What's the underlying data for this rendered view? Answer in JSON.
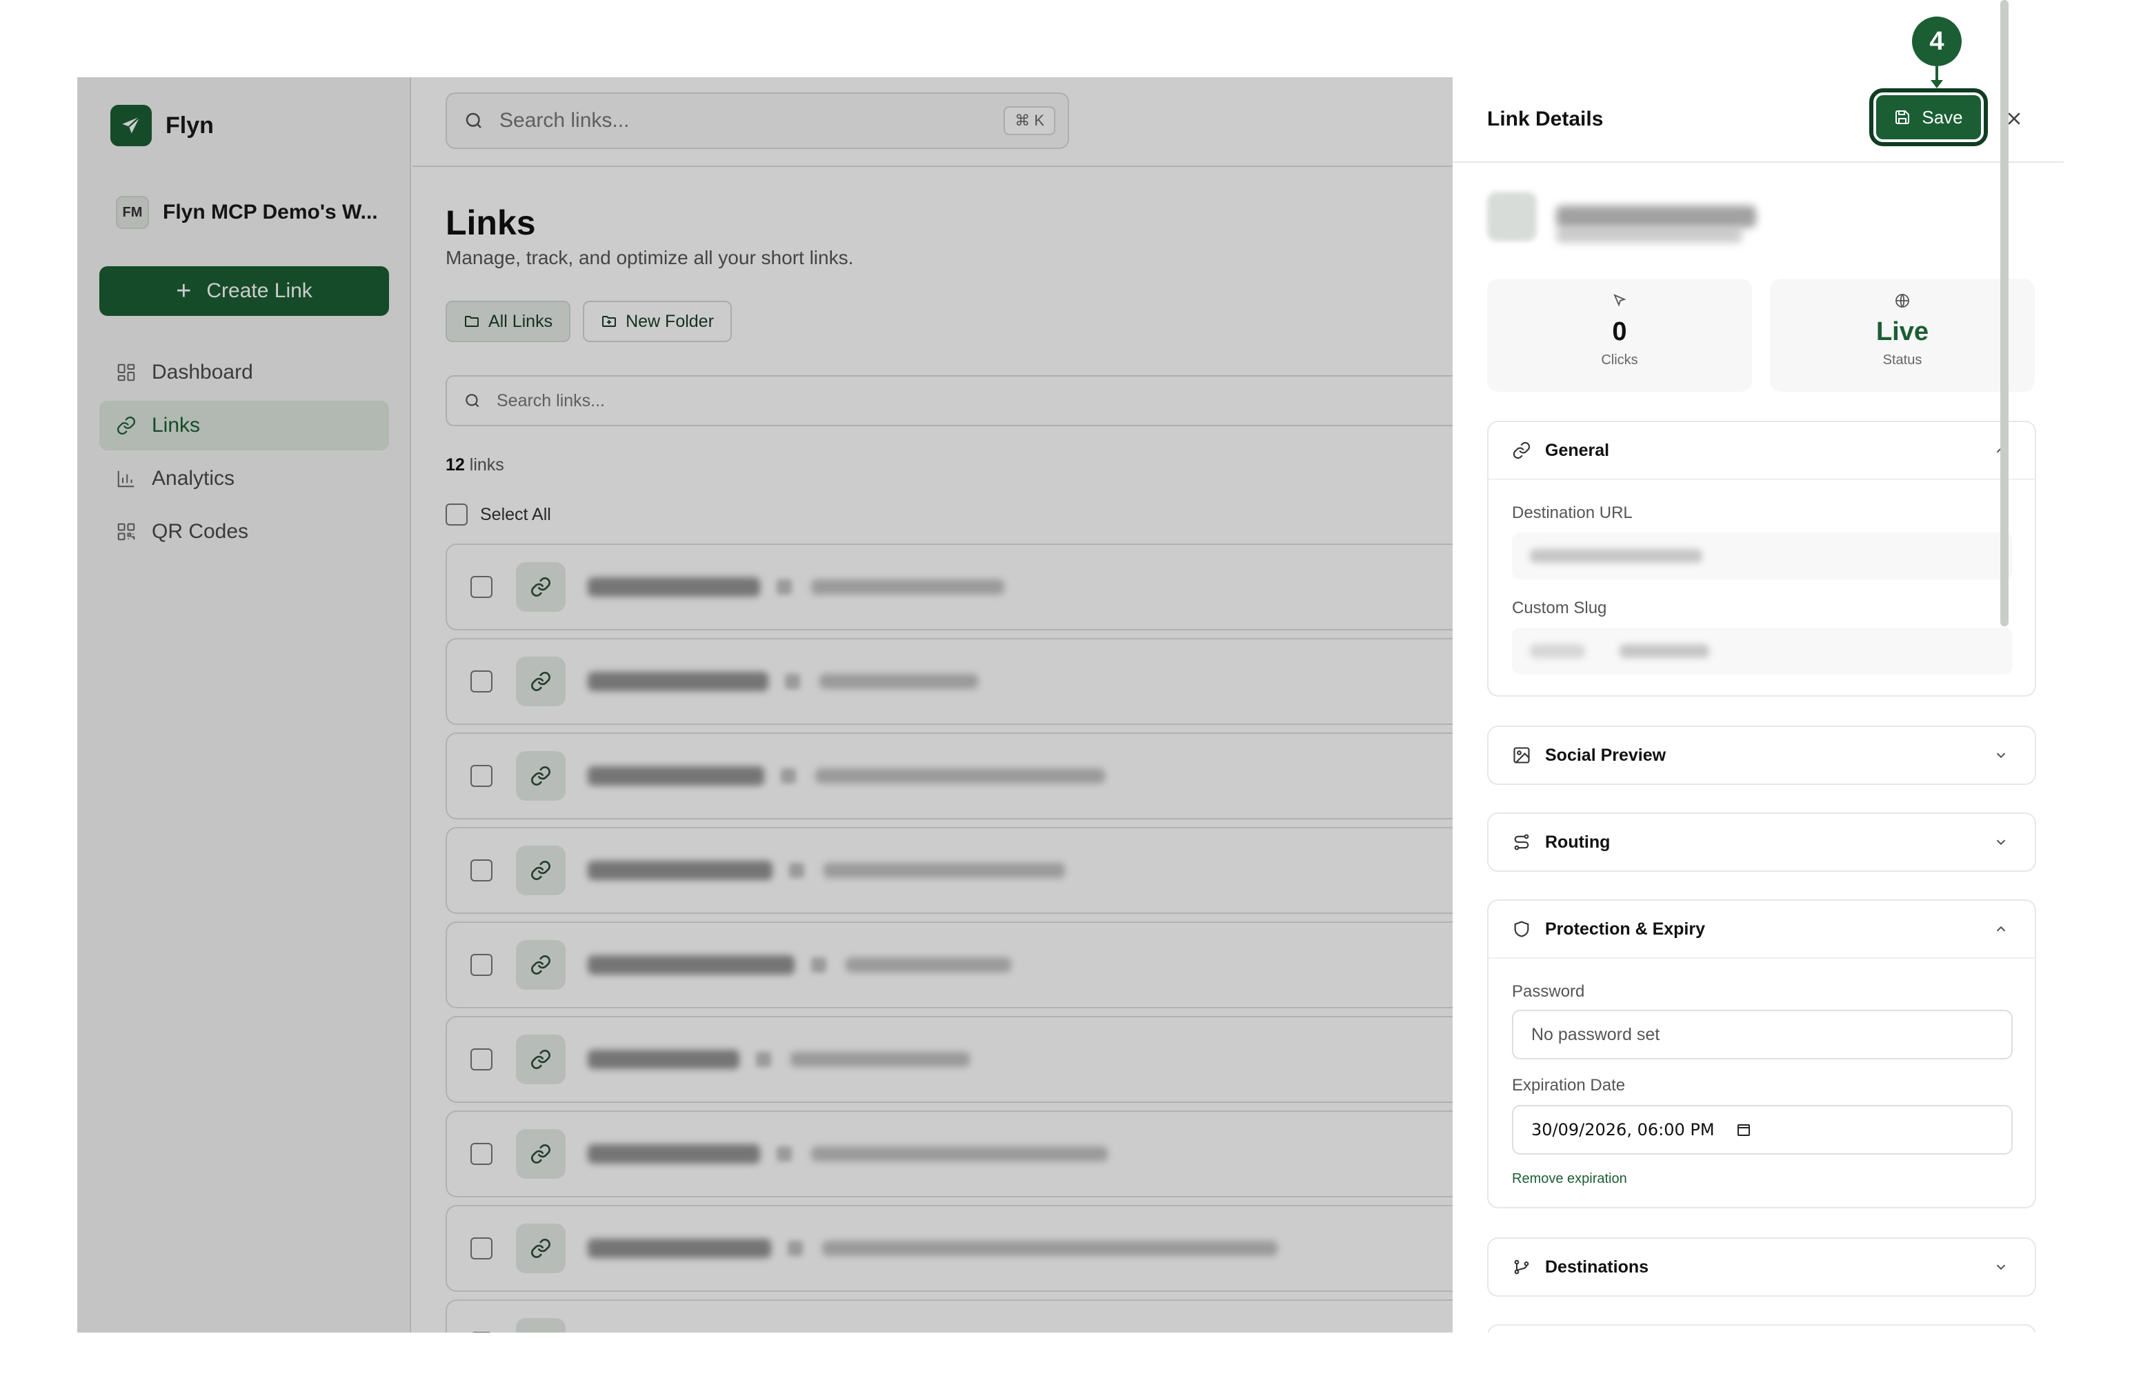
{
  "brand": {
    "name": "Flyn"
  },
  "workspace": {
    "initials": "FM",
    "name": "Flyn MCP Demo's W..."
  },
  "sidebar": {
    "create_label": "Create Link",
    "items": [
      {
        "label": "Dashboard",
        "icon": "dashboard-icon",
        "active": false
      },
      {
        "label": "Links",
        "icon": "link-icon",
        "active": true
      },
      {
        "label": "Analytics",
        "icon": "bar-chart-icon",
        "active": false
      },
      {
        "label": "QR Codes",
        "icon": "qr-code-icon",
        "active": false
      }
    ]
  },
  "topbar": {
    "search_placeholder": "Search links...",
    "shortcut": "⌘ K"
  },
  "main": {
    "title": "Links",
    "subtitle": "Manage, track, and optimize all your short links.",
    "folders": {
      "all_label": "All Links",
      "new_label": "New Folder"
    },
    "search_placeholder": "Search links...",
    "count_number": "12",
    "count_suffix": "links",
    "select_all_label": "Select All"
  },
  "drawer": {
    "title": "Link Details",
    "save_label": "Save",
    "stats": {
      "clicks_value": "0",
      "clicks_label": "Clicks",
      "status_value": "Live",
      "status_label": "Status"
    },
    "general": {
      "title": "General",
      "destination_label": "Destination URL",
      "slug_label": "Custom Slug"
    },
    "social_title": "Social Preview",
    "routing_title": "Routing",
    "protection": {
      "title": "Protection & Expiry",
      "password_label": "Password",
      "password_placeholder": "No password set",
      "expiration_label": "Expiration Date",
      "expiration_value": "30/09/2026, 06:00 PM",
      "remove_label": "Remove expiration"
    },
    "destinations_title": "Destinations"
  },
  "annotation": {
    "step_number": "4"
  },
  "colors": {
    "brand": "#1b5e34",
    "overlay": "rgba(0,0,0,0.2)"
  }
}
